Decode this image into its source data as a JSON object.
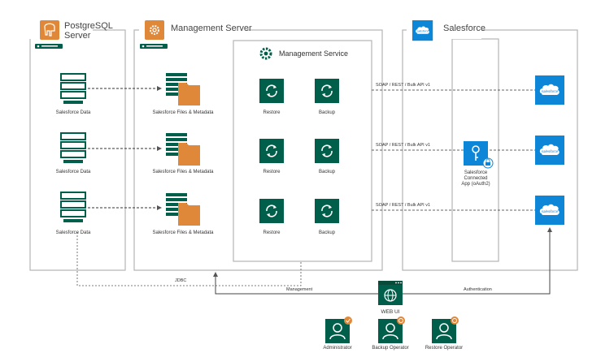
{
  "colors": {
    "green": "#005f4b",
    "orange": "#e0883a",
    "salesforce_blue": "#0d86d8",
    "line": "#b5b5b5",
    "dark_line": "#666666"
  },
  "postgres": {
    "title_line1": "PostgreSQL",
    "title_line2": "Server",
    "icon": "elephant-icon",
    "items": [
      {
        "label": "Salesforce Data"
      },
      {
        "label": "Salesforce Data"
      },
      {
        "label": "Salesforce Data"
      }
    ]
  },
  "management_server": {
    "title": "Management Server",
    "icon": "gear-icon",
    "files": [
      {
        "label": "Salesforce Files & Metadata"
      },
      {
        "label": "Salesforce Files & Metadata"
      },
      {
        "label": "Salesforce Files & Metadata"
      }
    ]
  },
  "management_service": {
    "title": "Management Service",
    "actions": [
      {
        "restore": "Restore",
        "backup": "Backup"
      },
      {
        "restore": "Restore",
        "backup": "Backup"
      },
      {
        "restore": "Restore",
        "backup": "Backup"
      }
    ]
  },
  "salesforce": {
    "title": "Salesforce",
    "logo_text": "salesforce",
    "connected_app_line1": "Salesforce",
    "connected_app_line2": "Connected",
    "connected_app_line3": "App (oAuth2)",
    "api_labels": [
      "SOAP / REST / Bulk API v1",
      "SOAP / REST / Bulk API v1",
      "SOAP / REST / Bulk API v1"
    ]
  },
  "connections": {
    "jdbc": "JDBC",
    "management": "Management",
    "authentication": "Authentication"
  },
  "web_ui": {
    "label": "WEB UI"
  },
  "users": [
    {
      "label": "Administrator",
      "badge": "check-badge-icon"
    },
    {
      "label": "Backup Operator",
      "badge": "backup-badge-icon"
    },
    {
      "label": "Restore Operator",
      "badge": "restore-badge-icon"
    }
  ]
}
